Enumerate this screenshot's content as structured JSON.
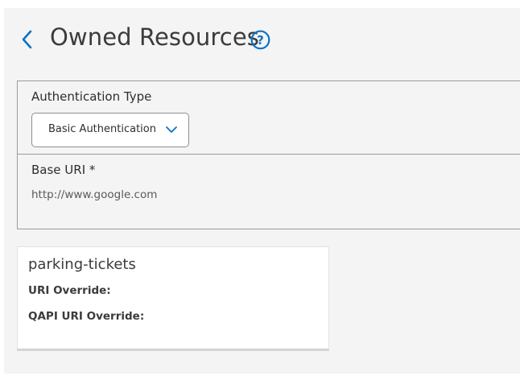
{
  "header": {
    "title": "Owned Resources",
    "back_icon": "chevron-left-icon",
    "help_icon": "question-circle-icon",
    "accent_color": "#0b72c6"
  },
  "form": {
    "auth_type_label": "Authentication Type",
    "auth_type_value": "Basic Authentication",
    "base_uri_label": "Base URI *",
    "base_uri_value": "http://www.google.com"
  },
  "resource_card": {
    "name": "parking-tickets",
    "fields": [
      {
        "label": "URI Override:"
      },
      {
        "label": "QAPI URI Override:"
      }
    ]
  }
}
